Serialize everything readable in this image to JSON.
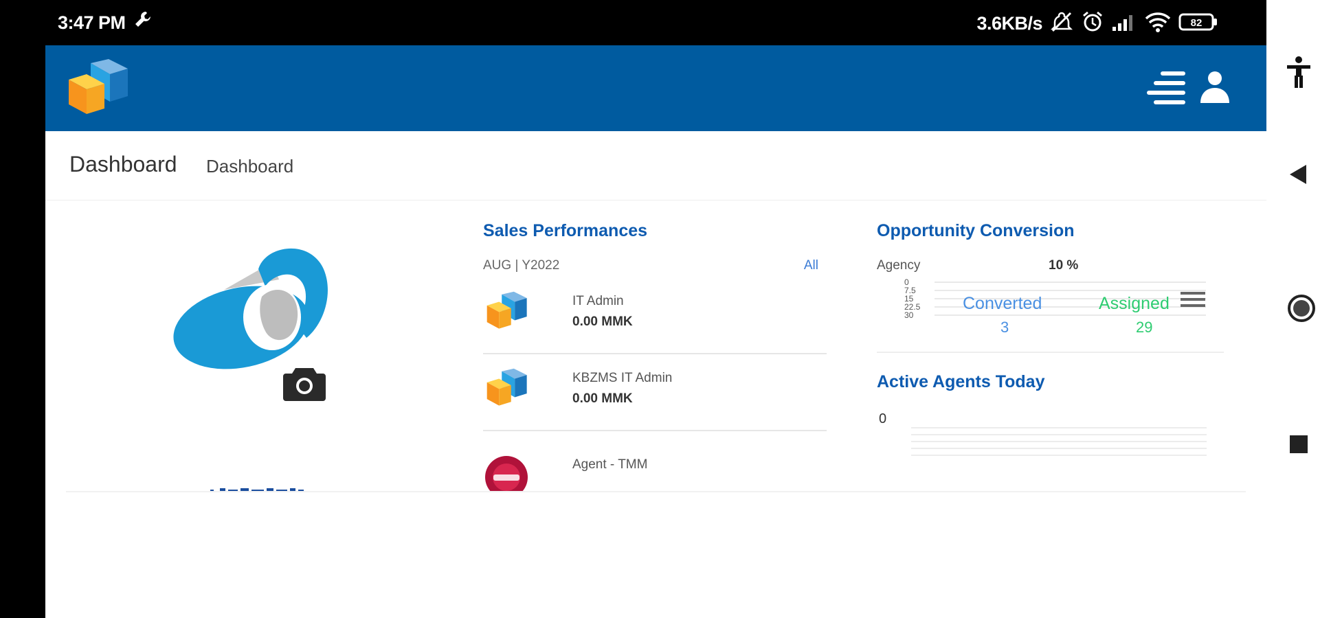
{
  "status_bar": {
    "time": "3:47 PM",
    "network_speed": "3.6KB/s",
    "battery_level": "82"
  },
  "header": {
    "logo": "cube-logo",
    "icons": [
      "menu-icon",
      "user-icon"
    ]
  },
  "page": {
    "title": "Dashboard",
    "breadcrumb": "Dashboard"
  },
  "sales": {
    "title": "Sales Performances",
    "period": "AUG | Y2022",
    "all_link": "All",
    "agents": [
      {
        "name": "IT Admin",
        "amount": "0.00 MMK"
      },
      {
        "name": "KBZMS IT Admin",
        "amount": "0.00 MMK"
      },
      {
        "name": "Agent - TMM",
        "amount": ""
      }
    ]
  },
  "opportunity": {
    "title": "Opportunity Conversion",
    "filter_label": "Agency",
    "percent": "10 %",
    "y_ticks": [
      "0",
      "7.5",
      "15",
      "22.5",
      "30"
    ],
    "converted_label": "Converted",
    "converted_value": "3",
    "assigned_label": "Assigned",
    "assigned_value": "29"
  },
  "active_agents": {
    "title": "Active Agents Today",
    "count": "0"
  },
  "colors": {
    "header_blue": "#005b9f",
    "title_blue": "#0e5bb0",
    "converted_blue": "#4a90e2",
    "assigned_green": "#2ecc71"
  }
}
